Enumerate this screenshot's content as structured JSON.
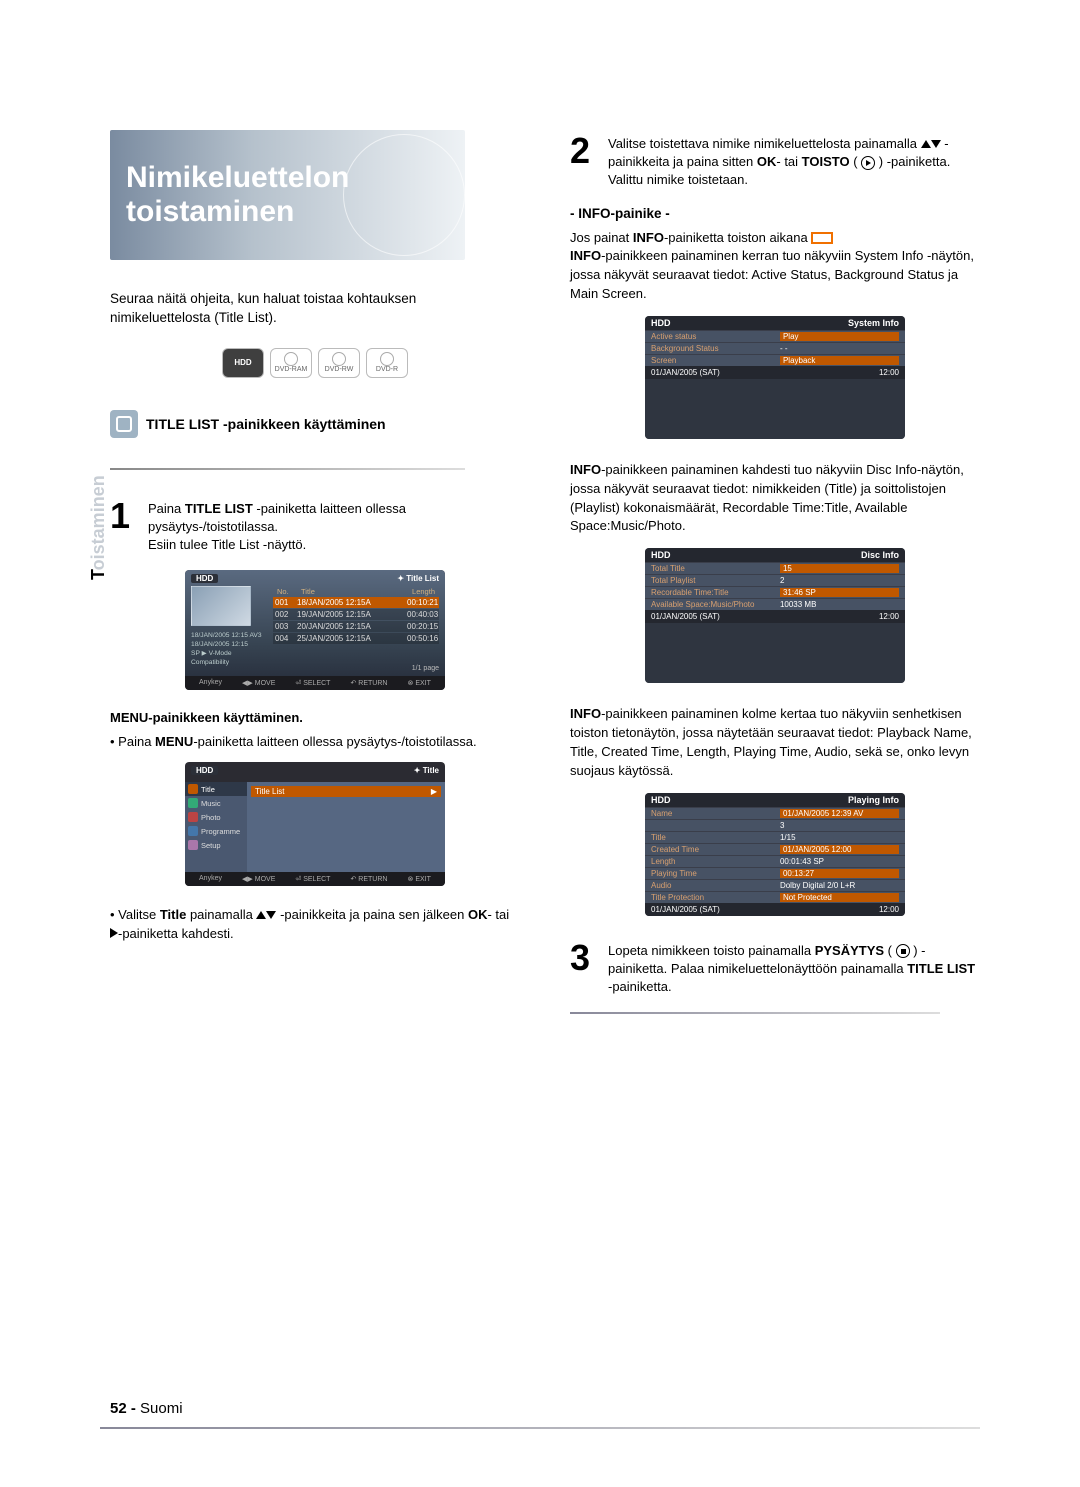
{
  "title": {
    "line1": "Nimikeluettelon",
    "line2": "toistaminen"
  },
  "intro": "Seuraa näitä ohjeita, kun haluat toistaa kohtauksen nimikeluettelosta (Title List).",
  "discs": [
    "HDD",
    "DVD-RAM",
    "DVD-RW",
    "DVD-R"
  ],
  "section1": {
    "title": "TITLE LIST -painikkeen käyttäminen"
  },
  "step1": {
    "num": "1",
    "text_a": "Paina ",
    "text_b": "TITLE LIST",
    "text_c": " -painiketta laitteen ollessa pysäytys-/toistotilassa.",
    "text_d": "Esiin tulee Title List -näyttö."
  },
  "osd1": {
    "hdd": "HDD",
    "label": "Title List",
    "cols": {
      "a": "No.",
      "b": "Title",
      "c": "Length"
    },
    "rows": [
      {
        "no": "001",
        "t": "18/JAN/2005 12:15A",
        "len": "00:10:21",
        "sel": true
      },
      {
        "no": "002",
        "t": "19/JAN/2005 12:15A",
        "len": "00:40:03"
      },
      {
        "no": "003",
        "t": "20/JAN/2005 12:15A",
        "len": "00:20:15"
      },
      {
        "no": "004",
        "t": "25/JAN/2005 12:15A",
        "len": "00:50:16"
      }
    ],
    "meta1": "18/JAN/2005 12:15 AV3",
    "meta2": "18/JAN/2005 12:15",
    "meta3": "SP ▶ V-Mode Compatibility",
    "page": "1/1 page",
    "legend": [
      "Anykey",
      "◀▶ MOVE",
      "⏎ SELECT",
      "↶ RETURN",
      "⊗ EXIT"
    ]
  },
  "menuhead": "MENU-painikkeen käyttäminen.",
  "menubullet_a": "Paina ",
  "menubullet_b": "MENU",
  "menubullet_c": "-painiketta laitteen ollessa pysäytys-/toistotilassa.",
  "osd2": {
    "hdd": "HDD",
    "label": "Title",
    "left": [
      "Title",
      "Music",
      "Photo",
      "Programme",
      "Setup"
    ],
    "rightlabel": "Title List",
    "legend": [
      "Anykey",
      "◀▶ MOVE",
      "⏎ SELECT",
      "↶ RETURN",
      "⊗ EXIT"
    ]
  },
  "selectTitle_a": "Valitse ",
  "selectTitle_b": "Title",
  "selectTitle_c": " painamalla ",
  "selectTitle_d": " -painikkeita ja paina sen jälkeen ",
  "selectTitle_e": "OK",
  "selectTitle_f": "- tai ",
  "selectTitle_g": "-painiketta kahdesti.",
  "step2": {
    "num": "2",
    "a": "Valitse toistettava nimike nimikeluettelosta painamalla ",
    "b": " -painikkeita ja paina sitten ",
    "c": "OK",
    "d": "- tai ",
    "e": "TOISTO",
    "f": " ( ",
    "g": " ) -painiketta.",
    "h": "Valittu nimike toistetaan."
  },
  "infosec": {
    "head": "- INFO-painike -",
    "p1_a": "Jos painat ",
    "p1_b": "INFO",
    "p1_c": "-painiketta toiston aikana",
    "p1_d": "INFO",
    "p1_e": "-painikkeen painaminen kerran tuo näkyviin System Info -näytön, jossa näkyvät seuraavat tiedot: Active Status, Background Status ja Main Screen."
  },
  "sysinfo": {
    "hdr_l": "HDD",
    "hdr_r": "System Info",
    "rows": [
      {
        "k": "Active status",
        "v": "Play",
        "alt": true
      },
      {
        "k": "Background Status",
        "v": "- -"
      },
      {
        "k": "Screen",
        "v": "Playback",
        "alt": true
      }
    ],
    "foot_l": "01/JAN/2005 (SAT)",
    "foot_r": "12:00"
  },
  "p2_a": "INFO",
  "p2_b": "-painikkeen painaminen kahdesti tuo näkyviin Disc Info-näytön, jossa näkyvät seuraavat tiedot: nimikkeiden (Title) ja soittolistojen (Playlist) kokonaismäärät, Recordable Time:Title, Available Space:Music/Photo.",
  "discinfo": {
    "hdr_l": "HDD",
    "hdr_r": "Disc Info",
    "rows": [
      {
        "k": "Total Title",
        "v": "15",
        "alt": true
      },
      {
        "k": "Total Playlist",
        "v": "2"
      },
      {
        "k": "Recordable Time:Title",
        "v": "31:46  SP",
        "alt": true
      },
      {
        "k": "Available Space:Music/Photo",
        "v": "10033 MB"
      }
    ],
    "foot_l": "01/JAN/2005 (SAT)",
    "foot_r": "12:00"
  },
  "p3_a": "INFO",
  "p3_b": "-painikkeen painaminen kolme kertaa tuo näkyviin senhetkisen toiston tietonäytön, jossa näytetään seuraavat tiedot: Playback Name, Title, Created Time, Length, Playing Time, Audio, sekä se, onko levyn suojaus käytössä.",
  "playinfo": {
    "hdr_l": "HDD",
    "hdr_r": "Playing Info",
    "rows": [
      {
        "k": "Name",
        "v": "01/JAN/2005 12:39 AV",
        "alt": true
      },
      {
        "k": "",
        "v": "3"
      },
      {
        "k": "Title",
        "v": "1/15"
      },
      {
        "k": "Created Time",
        "v": "01/JAN/2005 12:00",
        "alt": true
      },
      {
        "k": "Length",
        "v": "00:01:43 SP"
      },
      {
        "k": "Playing Time",
        "v": "00:13:27",
        "alt": true
      },
      {
        "k": "Audio",
        "v": "Dolby Digital 2/0 L+R"
      },
      {
        "k": "Title Protection",
        "v": "Not Protected",
        "alt": true
      }
    ],
    "foot_l": "01/JAN/2005 (SAT)",
    "foot_r": "12:00"
  },
  "step3": {
    "num": "3",
    "a": "Lopeta nimikkeen toisto painamalla  ",
    "b": "PYSÄYTYS",
    "c": " ( ",
    "d": " ) -painiketta. Palaa nimikeluettelonäyttöön painamalla ",
    "e": "TITLE LIST",
    "f": " -painiketta."
  },
  "sidebar": {
    "dark": "T",
    "faded": "oistaminen"
  },
  "footer": {
    "page": "52 - ",
    "lang": "Suomi"
  }
}
